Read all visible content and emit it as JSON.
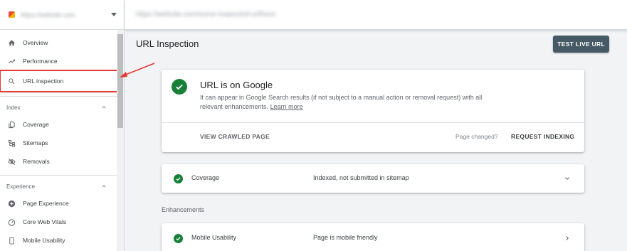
{
  "header": {
    "property_url": "https://website.com",
    "inspected_url": "https://website.com/some-inspected-url/here"
  },
  "sidebar": {
    "items": [
      {
        "label": "Overview",
        "icon": "home-icon"
      },
      {
        "label": "Performance",
        "icon": "trending-icon"
      },
      {
        "label": "URL inspection",
        "icon": "search-icon",
        "active": true
      }
    ],
    "sections": [
      {
        "title": "Index",
        "items": [
          {
            "label": "Coverage",
            "icon": "pages-icon"
          },
          {
            "label": "Sitemaps",
            "icon": "sitemap-icon"
          },
          {
            "label": "Removals",
            "icon": "eye-off-icon"
          }
        ]
      },
      {
        "title": "Experience",
        "items": [
          {
            "label": "Page Experience",
            "icon": "plus-circle-icon"
          },
          {
            "label": "Core Web Vitals",
            "icon": "gauge-icon"
          },
          {
            "label": "Mobile Usability",
            "icon": "phone-icon"
          }
        ]
      }
    ]
  },
  "main": {
    "title": "URL Inspection",
    "test_live_button": "TEST LIVE URL",
    "verdict": {
      "title": "URL is on Google",
      "description": "It can appear in Google Search results (if not subject to a manual action or removal request) with all relevant enhancements.",
      "learn_more": "Learn more",
      "view_crawled": "VIEW CRAWLED PAGE",
      "page_changed": "Page changed?",
      "request_indexing": "REQUEST INDEXING"
    },
    "coverage": {
      "label": "Coverage",
      "value": "Indexed, not submitted in sitemap"
    },
    "enhancements_label": "Enhancements",
    "mobile": {
      "label": "Mobile Usability",
      "value": "Page is mobile friendly"
    }
  },
  "colors": {
    "success": "#188038",
    "button": "#455a64",
    "highlight": "#e53935"
  }
}
